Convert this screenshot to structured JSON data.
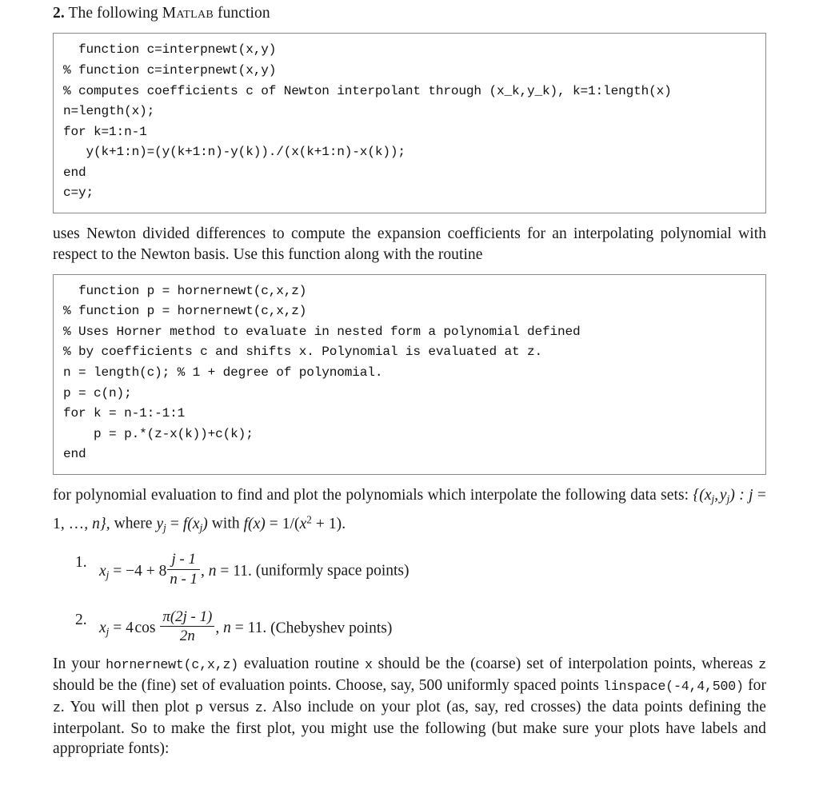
{
  "document": {
    "problem_number": "2.",
    "heading_before": "The following ",
    "heading_smallcaps": "Matlab",
    "heading_after": " function",
    "code_block_1": "  function c=interpnewt(x,y)\n% function c=interpnewt(x,y)\n% computes coefficients c of Newton interpolant through (x_k,y_k), k=1:length(x)\nn=length(x);\nfor k=1:n-1\n   y(k+1:n)=(y(k+1:n)-y(k))./(x(k+1:n)-x(k));\nend\nc=y;",
    "paragraph_1": "uses Newton divided differences to compute the expansion coefficients for an interpolating polynomial with respect to the Newton basis. Use this function along with the routine",
    "code_block_2": "  function p = hornernewt(c,x,z)\n% function p = hornernewt(c,x,z)\n% Uses Horner method to evaluate in nested form a polynomial defined\n% by coefficients c and shifts x. Polynomial is evaluated at z.\nn = length(c); % 1 + degree of polynomial.\np = c(n);\nfor k = n-1:-1:1\n    p = p.*(z-x(k))+c(k);\nend",
    "paragraph_2_line1": "for polynomial evaluation to find and plot the polynomials which interpolate the following data",
    "paragraph_2_prefix": "sets: ",
    "paragraph_2_math_sets": "{(x_j, y_j) : j = 1, …, n},",
    "paragraph_2_mid": " where ",
    "paragraph_2_math_y": "y_j = f(x_j)",
    "paragraph_2_mid2": " with ",
    "paragraph_2_math_f": "f(x) = 1/(x^2 + 1).",
    "list": [
      {
        "marker": "1.",
        "formula_lhs": "x_j = -4 + 8",
        "frac_num": "j - 1",
        "frac_den": "n - 1",
        "formula_tail": ", n = 11.",
        "note": "(uniformly space points)"
      },
      {
        "marker": "2.",
        "formula_lhs": "x_j = 4 cos",
        "frac_num": "π(2j - 1)",
        "frac_den": "2n",
        "formula_tail": ", n = 11.",
        "note": "(Chebyshev points)"
      }
    ],
    "paragraph_3": {
      "t1": "In your ",
      "code1": "hornernewt(c,x,z)",
      "t2": " evaluation routine ",
      "code2": "x",
      "t3": " should be the (coarse) set of interpolation points, whereas ",
      "code3": "z",
      "t4": " should be the (fine) set of evaluation points. Choose, say, 500 uniformly spaced points ",
      "code4": "linspace(-4,4,500)",
      "t5": " for ",
      "code5": "z",
      "t6": ". You will then plot ",
      "code6": "p",
      "t7": " versus ",
      "code7": "z",
      "t8": ". Also include on your plot (as, say, red crosses) the data points defining the interpolant. So to make the first plot, you might use the following (but make sure your plots have labels and appropriate fonts):"
    }
  }
}
